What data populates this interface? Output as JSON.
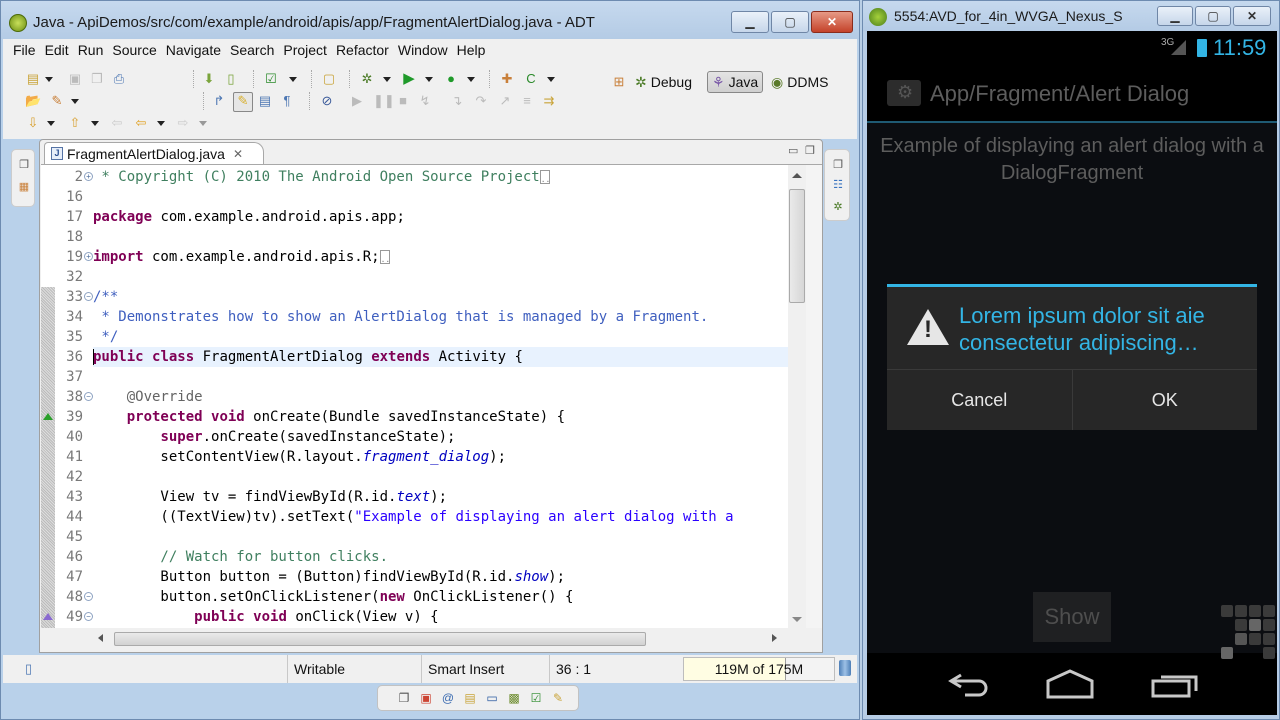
{
  "adt": {
    "title": "Java - ApiDemos/src/com/example/android/apis/app/FragmentAlertDialog.java - ADT",
    "window_controls": {
      "minimize": "▁",
      "maximize": "▢",
      "close": "✕"
    },
    "menu": [
      "File",
      "Edit",
      "Run",
      "Source",
      "Navigate",
      "Search",
      "Project",
      "Refactor",
      "Window",
      "Help"
    ],
    "toolbar_icons": [
      "new-icon",
      "save-icon",
      "save-all-icon",
      "print-icon",
      "android-sdk-manager-icon",
      "android-avd-manager-icon",
      "tasks-icon",
      "new-android-project-icon",
      "debug-icon",
      "run-icon",
      "external-tools-icon",
      "new-java-package-icon",
      "new-java-class-icon",
      "open-type-icon",
      "search-icon",
      "toggle-breadcrumb-icon",
      "mark-occurrences-icon",
      "block-selection-icon",
      "show-whitespace-icon",
      "skip-breakpoints-icon",
      "resume-icon",
      "suspend-icon",
      "terminate-icon",
      "disconnect-icon",
      "step-into-icon",
      "step-over-icon",
      "step-return-icon",
      "drop-to-frame-icon",
      "use-step-filters-icon",
      "next-annotation-icon",
      "previous-annotation-icon",
      "back-icon",
      "forward-icon"
    ],
    "perspectives": [
      {
        "label": "Debug",
        "icon": "bug-icon",
        "active": false
      },
      {
        "label": "Java",
        "icon": "java-perspective-icon",
        "active": true
      },
      {
        "label": "DDMS",
        "icon": "ddms-icon",
        "active": false
      }
    ],
    "editor": {
      "tab_label": "FragmentAlertDialog.java",
      "current_line": 36,
      "lines": [
        {
          "n": "2",
          "fold": "expand",
          "segments": [
            {
              "t": " * Copyright (C) 2010 The Android Open Source Project",
              "c": "cm"
            }
          ],
          "folded": true
        },
        {
          "n": "16",
          "segments": []
        },
        {
          "n": "17",
          "segments": [
            {
              "t": "package",
              "c": "kw"
            },
            {
              "t": " com.example.android.apis.app;",
              "c": ""
            }
          ]
        },
        {
          "n": "18",
          "segments": []
        },
        {
          "n": "19",
          "fold": "expand",
          "segments": [
            {
              "t": "import",
              "c": "kw"
            },
            {
              "t": " com.example.android.apis.R;",
              "c": ""
            }
          ],
          "folded": true
        },
        {
          "n": "32",
          "segments": []
        },
        {
          "n": "33",
          "fold": "collapse",
          "segments": [
            {
              "t": "/**",
              "c": "jd"
            }
          ]
        },
        {
          "n": "34",
          "segments": [
            {
              "t": " * Demonstrates how to show an AlertDialog that is managed by a Fragment.",
              "c": "jd"
            }
          ]
        },
        {
          "n": "35",
          "segments": [
            {
              "t": " */",
              "c": "jd"
            }
          ]
        },
        {
          "n": "36",
          "segments": [
            {
              "t": "public",
              "c": "kw"
            },
            {
              "t": " ",
              "c": ""
            },
            {
              "t": "class",
              "c": "kw"
            },
            {
              "t": " FragmentAlertDialog ",
              "c": ""
            },
            {
              "t": "extends",
              "c": "kw"
            },
            {
              "t": " Activity {",
              "c": ""
            }
          ]
        },
        {
          "n": "37",
          "segments": []
        },
        {
          "n": "38",
          "fold": "collapse",
          "segments": [
            {
              "t": "    @Override",
              "c": "an"
            }
          ]
        },
        {
          "n": "39",
          "marker": "override",
          "segments": [
            {
              "t": "    ",
              "c": ""
            },
            {
              "t": "protected",
              "c": "kw"
            },
            {
              "t": " ",
              "c": ""
            },
            {
              "t": "void",
              "c": "kw"
            },
            {
              "t": " onCreate(Bundle savedInstanceState) {",
              "c": ""
            }
          ]
        },
        {
          "n": "40",
          "segments": [
            {
              "t": "        ",
              "c": ""
            },
            {
              "t": "super",
              "c": "kw"
            },
            {
              "t": ".onCreate(savedInstanceState);",
              "c": ""
            }
          ]
        },
        {
          "n": "41",
          "segments": [
            {
              "t": "        setContentView(R.layout.",
              "c": ""
            },
            {
              "t": "fragment_dialog",
              "c": "it"
            },
            {
              "t": ");",
              "c": ""
            }
          ]
        },
        {
          "n": "42",
          "segments": []
        },
        {
          "n": "43",
          "segments": [
            {
              "t": "        View tv = findViewById(R.id.",
              "c": ""
            },
            {
              "t": "text",
              "c": "it"
            },
            {
              "t": ");",
              "c": ""
            }
          ]
        },
        {
          "n": "44",
          "segments": [
            {
              "t": "        ((TextView)tv).setText(",
              "c": ""
            },
            {
              "t": "\"Example of displaying an alert dialog with a",
              "c": "str"
            }
          ]
        },
        {
          "n": "45",
          "segments": []
        },
        {
          "n": "46",
          "segments": [
            {
              "t": "        // Watch for button clicks.",
              "c": "cm"
            }
          ]
        },
        {
          "n": "47",
          "segments": [
            {
              "t": "        Button button = (Button)findViewById(R.id.",
              "c": ""
            },
            {
              "t": "show",
              "c": "it"
            },
            {
              "t": ");",
              "c": ""
            }
          ]
        },
        {
          "n": "48",
          "fold": "collapse",
          "segments": [
            {
              "t": "        button.setOnClickListener(",
              "c": ""
            },
            {
              "t": "new",
              "c": "kw"
            },
            {
              "t": " OnClickListener() {",
              "c": ""
            }
          ]
        },
        {
          "n": "49",
          "fold": "collapse",
          "marker": "implements",
          "segments": [
            {
              "t": "            ",
              "c": ""
            },
            {
              "t": "public",
              "c": "kw"
            },
            {
              "t": " ",
              "c": ""
            },
            {
              "t": "void",
              "c": "kw"
            },
            {
              "t": " onClick(View v) {",
              "c": ""
            }
          ]
        }
      ]
    },
    "status": {
      "writable": "Writable",
      "insert_mode": "Smart Insert",
      "position": "36 : 1",
      "heap_label": "119M of 175M",
      "heap_used_mb": 119,
      "heap_total_mb": 175
    }
  },
  "emulator": {
    "title": "5554:AVD_for_4in_WVGA_Nexus_S",
    "window_controls": {
      "minimize": "▁",
      "maximize": "▢",
      "close": "✕"
    },
    "status_bar": {
      "network": "3G",
      "clock": "11:59"
    },
    "action_bar_title": "App/Fragment/Alert Dialog",
    "content_text": "Example of displaying an alert dialog with a DialogFragment",
    "dialog": {
      "title": "Lorem ipsum dolor sit aie consectetur adipiscing…",
      "icon": "warning-icon",
      "cancel_label": "Cancel",
      "ok_label": "OK"
    },
    "show_button_label": "Show",
    "accent_color": "#33b5e5"
  }
}
